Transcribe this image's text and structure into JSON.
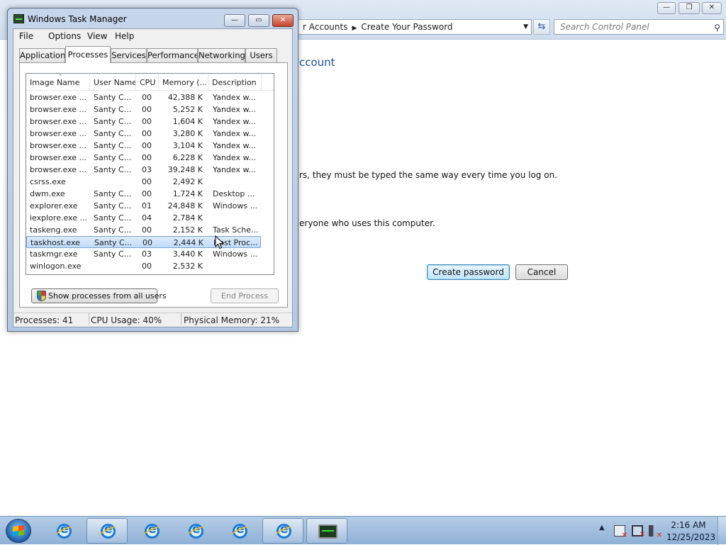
{
  "control_panel": {
    "breadcrumb": [
      "r Accounts",
      "Create Your Password"
    ],
    "search_placeholder": "Search Control Panel",
    "heading": "ccount",
    "text_line_1": "rs, they must be typed the same way every time you log on.",
    "text_line_2": "eryone who uses this computer.",
    "create_button": "Create password",
    "cancel_button": "Cancel"
  },
  "task_manager": {
    "title": "Windows Task Manager",
    "menu": [
      "File",
      "Options",
      "View",
      "Help"
    ],
    "tabs": [
      "Applications",
      "Processes",
      "Services",
      "Performance",
      "Networking",
      "Users"
    ],
    "active_tab": "Processes",
    "columns": [
      "Image Name",
      "User Name",
      "CPU",
      "Memory (...",
      "Description"
    ],
    "rows": [
      {
        "image": "browser.exe ...",
        "user": "Santy C...",
        "cpu": "00",
        "mem": "42,388 K",
        "desc": "Yandex w..."
      },
      {
        "image": "browser.exe ...",
        "user": "Santy C...",
        "cpu": "00",
        "mem": "5,252 K",
        "desc": "Yandex w..."
      },
      {
        "image": "browser.exe ...",
        "user": "Santy C...",
        "cpu": "00",
        "mem": "1,604 K",
        "desc": "Yandex w..."
      },
      {
        "image": "browser.exe ...",
        "user": "Santy C...",
        "cpu": "00",
        "mem": "3,280 K",
        "desc": "Yandex w..."
      },
      {
        "image": "browser.exe ...",
        "user": "Santy C...",
        "cpu": "00",
        "mem": "3,104 K",
        "desc": "Yandex w..."
      },
      {
        "image": "browser.exe ...",
        "user": "Santy C...",
        "cpu": "00",
        "mem": "6,228 K",
        "desc": "Yandex w..."
      },
      {
        "image": "browser.exe ...",
        "user": "Santy C...",
        "cpu": "03",
        "mem": "39,248 K",
        "desc": "Yandex w..."
      },
      {
        "image": "csrss.exe",
        "user": "",
        "cpu": "00",
        "mem": "2,492 K",
        "desc": ""
      },
      {
        "image": "dwm.exe",
        "user": "Santy C...",
        "cpu": "00",
        "mem": "1,724 K",
        "desc": "Desktop ..."
      },
      {
        "image": "explorer.exe",
        "user": "Santy C...",
        "cpu": "01",
        "mem": "24,848 K",
        "desc": "Windows ..."
      },
      {
        "image": "iexplore.exe ...",
        "user": "Santy C...",
        "cpu": "04",
        "mem": "2,784 K",
        "desc": ""
      },
      {
        "image": "taskeng.exe",
        "user": "Santy C...",
        "cpu": "00",
        "mem": "2,152 K",
        "desc": "Task Sche..."
      },
      {
        "image": "taskhost.exe",
        "user": "Santy C...",
        "cpu": "00",
        "mem": "2,444 K",
        "desc": "Host Proc..."
      },
      {
        "image": "taskmgr.exe",
        "user": "Santy C...",
        "cpu": "03",
        "mem": "3,440 K",
        "desc": "Windows ..."
      },
      {
        "image": "winlogon.exe",
        "user": "",
        "cpu": "00",
        "mem": "2,532 K",
        "desc": ""
      }
    ],
    "selected_row": 12,
    "show_all_button": "Show processes from all users",
    "end_process_button": "End Process",
    "status": {
      "processes": "Processes: 41",
      "cpu": "CPU Usage: 40%",
      "memory": "Physical Memory: 21%"
    }
  },
  "taskbar": {
    "time": "2:16 AM",
    "date": "12/25/2023"
  }
}
